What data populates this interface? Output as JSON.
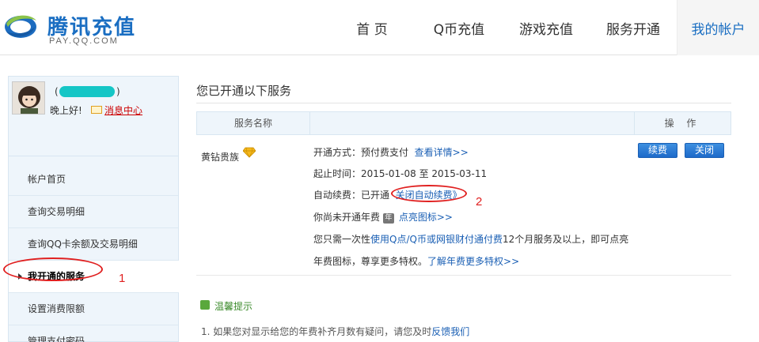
{
  "header": {
    "brand_name": "腾讯充值",
    "brand_domain": "PAY.QQ.COM",
    "nav": [
      {
        "label": "首 页"
      },
      {
        "label": "Q币充值"
      },
      {
        "label": "游戏充值"
      },
      {
        "label": "服务开通"
      },
      {
        "label": "我的帐户"
      }
    ],
    "active_nav": "我的帐户"
  },
  "sidebar": {
    "user_paren_left": "(",
    "user_paren_right": ")",
    "greeting": "晚上好!",
    "message_center": "消息中心",
    "menu": [
      {
        "label": "帐户首页"
      },
      {
        "label": "查询交易明细"
      },
      {
        "label": "查询QQ卡余额及交易明细"
      },
      {
        "label": "我开通的服务"
      },
      {
        "label": "设置消费限额"
      },
      {
        "label": "管理支付密码"
      }
    ],
    "active_menu": "我开通的服务"
  },
  "main": {
    "title": "您已开通以下服务",
    "table": {
      "col_name": "服务名称",
      "col_ops": "操 作"
    },
    "service": {
      "name": "黄钻贵族",
      "mode_label": "开通方式：",
      "mode_value": "预付费支付",
      "mode_link": "查看详情>>",
      "period_label": "起止时间：",
      "period_value": "2015-01-08 至  2015-03-11",
      "auto_label": "自动续费：",
      "auto_value": "已开通",
      "auto_link": "关闭自动续费》",
      "year_prefix": "你尚未开通年费",
      "year_icon": "年",
      "year_link": "点亮图标>>",
      "tip_prefix": "您只需一次性",
      "tip_link": "使用Q点/Q币或网银财付通付费",
      "tip_suffix": "12个月服务及以上，即可点亮",
      "tip_line2": "年费图标，尊享更多特权。",
      "tip_line2_link": "了解年费更多特权>>",
      "renew_button": "续费",
      "close_button": "关闭"
    },
    "warm_tips": {
      "title": "温馨提示",
      "item1_text": "1.   如果您对显示给您的年费补齐月数有疑问，请您及时",
      "item1_link": "反馈我们"
    }
  },
  "annotations": {
    "mark1": "1",
    "mark2": "2"
  },
  "colors": {
    "brand": "#1a6ec2",
    "link": "#1a5fb4",
    "annotation": "#e02020",
    "sidebar_bg": "#eef5fb"
  }
}
